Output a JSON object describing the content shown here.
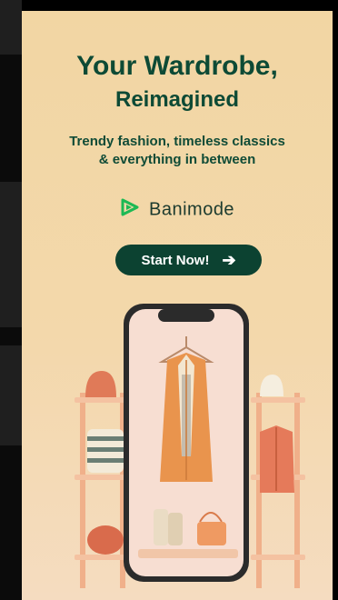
{
  "ad": {
    "headline_line1": "Your Wardrobe,",
    "headline_line2": "Reimagined",
    "subtitle_line1": "Trendy fashion, timeless classics",
    "subtitle_line2": "& everything in between",
    "brand_name": "Banimode",
    "cta_label": "Start Now!",
    "cta_icon": "arrow-right-icon"
  },
  "colors": {
    "background": "#f2d6a3",
    "text_primary": "#0d4a35",
    "cta_background": "#0c4231",
    "brand_logo": "#1db954",
    "accent_coral": "#e8865f"
  }
}
